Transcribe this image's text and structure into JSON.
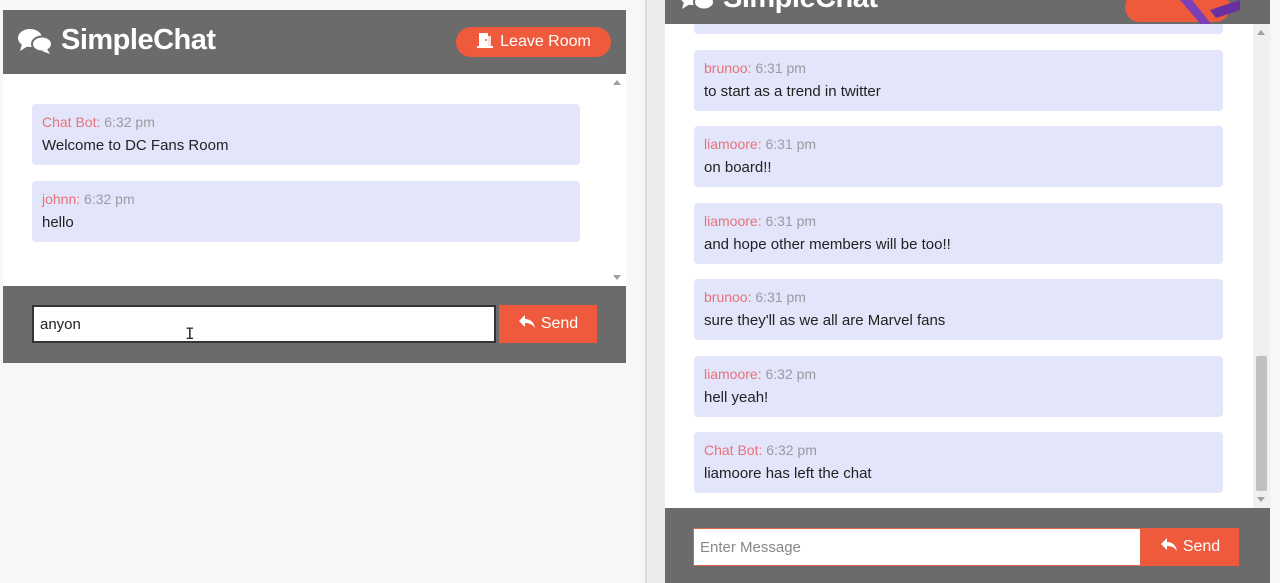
{
  "app": {
    "name": "SimpleChat",
    "accent_color": "#f05a3c",
    "header_color": "#6b6b6b",
    "bubble_color": "#e3e6fb"
  },
  "left": {
    "leave_label": "Leave Room",
    "messages": [
      {
        "author": "Chat Bot:",
        "time": "6:32 pm",
        "text": "Welcome to DC Fans Room"
      },
      {
        "author": "johnn:",
        "time": "6:32 pm",
        "text": "hello"
      }
    ],
    "input_value": "anyon",
    "send_label": "Send"
  },
  "right": {
    "messages": [
      {
        "author": "brunoo:",
        "time": "6:31 pm",
        "text": "to start as a trend in twitter"
      },
      {
        "author": "liamoore:",
        "time": "6:31 pm",
        "text": "on board!!"
      },
      {
        "author": "liamoore:",
        "time": "6:31 pm",
        "text": "and hope other members will be too!!"
      },
      {
        "author": "brunoo:",
        "time": "6:31 pm",
        "text": "sure they'll as we all are Marvel fans"
      },
      {
        "author": "liamoore:",
        "time": "6:32 pm",
        "text": "hell yeah!"
      },
      {
        "author": "Chat Bot:",
        "time": "6:32 pm",
        "text": "liamoore has left the chat"
      }
    ],
    "input_placeholder": "Enter Message",
    "send_label": "Send"
  }
}
